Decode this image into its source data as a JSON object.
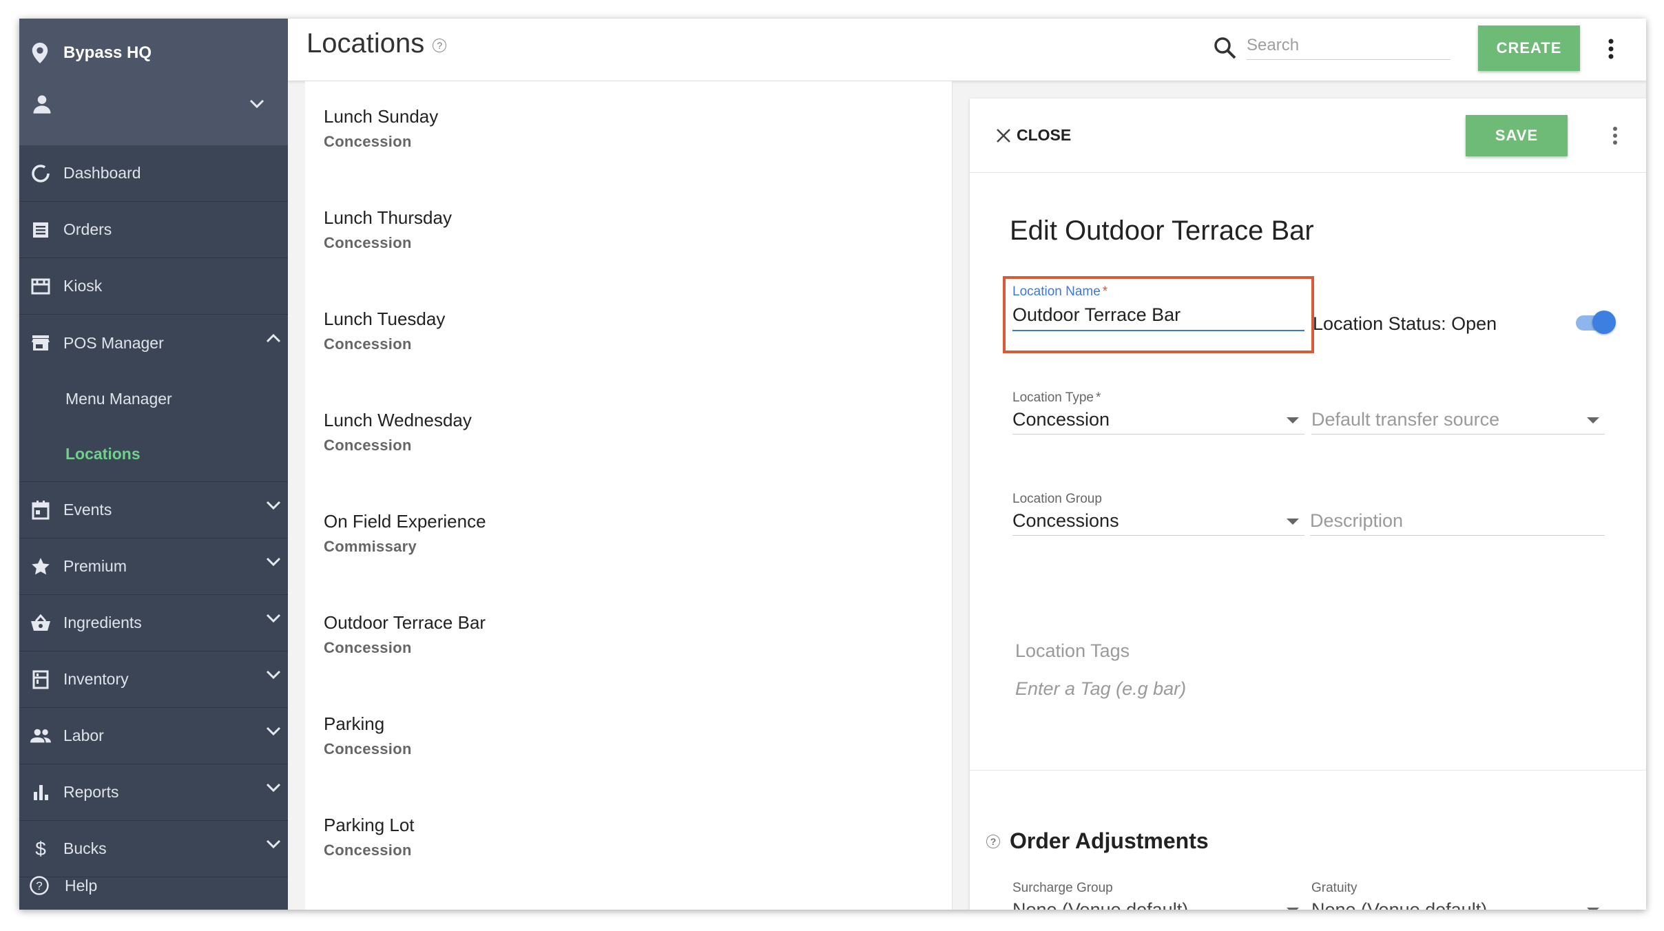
{
  "sidebar": {
    "venue": "Bypass HQ",
    "nav": [
      {
        "label": "Dashboard",
        "icon": "dashboard-icon"
      },
      {
        "label": "Orders",
        "icon": "orders-icon"
      },
      {
        "label": "Kiosk",
        "icon": "kiosk-icon"
      },
      {
        "label": "POS Manager",
        "icon": "store-icon",
        "expanded": true
      }
    ],
    "sub": [
      {
        "label": "Menu Manager"
      },
      {
        "label": "Locations",
        "active": true
      }
    ],
    "nav2": [
      {
        "label": "Events",
        "icon": "calendar-icon"
      },
      {
        "label": "Premium",
        "icon": "star-icon"
      },
      {
        "label": "Ingredients",
        "icon": "basket-icon"
      },
      {
        "label": "Inventory",
        "icon": "inventory-icon"
      },
      {
        "label": "Labor",
        "icon": "people-icon"
      },
      {
        "label": "Reports",
        "icon": "bar-chart-icon"
      },
      {
        "label": "Bucks",
        "icon": "dollar-icon"
      }
    ],
    "help": "Help"
  },
  "header": {
    "title": "Locations",
    "search_placeholder": "Search",
    "create_label": "CREATE"
  },
  "list": [
    {
      "name": "Lunch Sunday",
      "type": "Concession"
    },
    {
      "name": "Lunch Thursday",
      "type": "Concession"
    },
    {
      "name": "Lunch Tuesday",
      "type": "Concession"
    },
    {
      "name": "Lunch Wednesday",
      "type": "Concession"
    },
    {
      "name": "On Field Experience",
      "type": "Commissary"
    },
    {
      "name": "Outdoor Terrace Bar",
      "type": "Concession"
    },
    {
      "name": "Parking",
      "type": "Concession"
    },
    {
      "name": "Parking Lot",
      "type": "Concession"
    }
  ],
  "panel": {
    "close_label": "CLOSE",
    "save_label": "SAVE",
    "title": "Edit Outdoor Terrace Bar",
    "location_name_label": "Location Name",
    "location_name_value": "Outdoor Terrace Bar",
    "status_label": "Location Status: Open",
    "status_on": true,
    "location_type_label": "Location Type",
    "location_type_value": "Concession",
    "transfer_placeholder": "Default transfer source",
    "location_group_label": "Location Group",
    "location_group_value": "Concessions",
    "description_placeholder": "Description",
    "tags_label": "Location Tags",
    "tags_placeholder": "Enter a Tag (e.g bar)",
    "order_adjustments_title": "Order Adjustments",
    "surcharge_label": "Surcharge Group",
    "surcharge_value": "None (Venue default)",
    "gratuity_label": "Gratuity",
    "gratuity_value": "None (Venue default)"
  },
  "colors": {
    "sidebar_bg": "#3c4556",
    "accent_green": "#6dbb76",
    "active_text": "#6fd08b",
    "focus_blue": "#3b78d8",
    "highlight_border": "#d95a35"
  }
}
